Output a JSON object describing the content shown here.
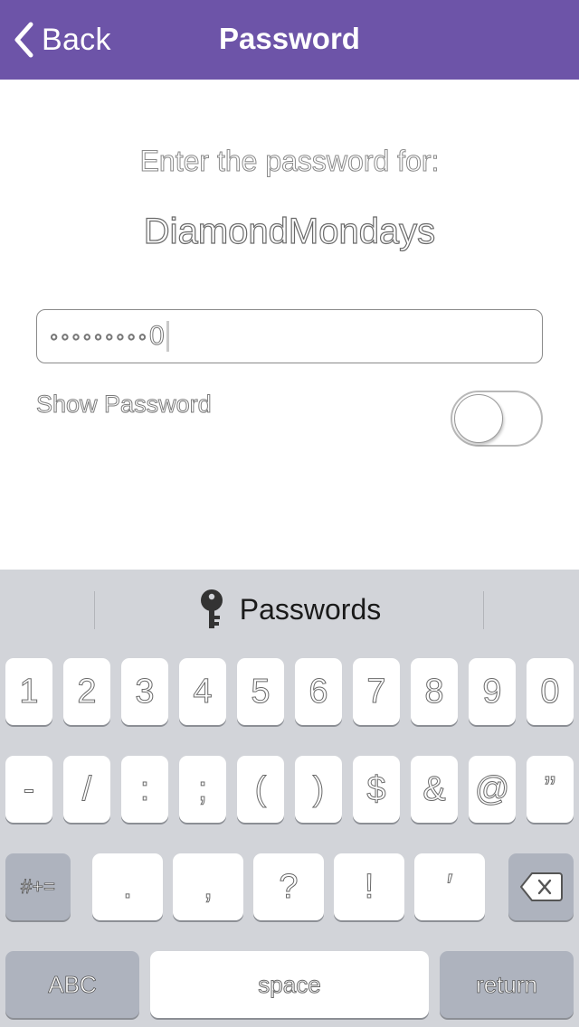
{
  "nav": {
    "back_label": "Back",
    "title": "Password",
    "bg_color": "#6d54a8"
  },
  "prompt": {
    "line1": "Enter the password for:",
    "network_name": "DiamondMondays"
  },
  "password_field": {
    "masked_value": "◦◦◦◦◦◦◦◦◦",
    "last_char": "0"
  },
  "show_password": {
    "label": "Show Password",
    "enabled": false
  },
  "keyboard": {
    "suggestion": {
      "icon": "key-icon",
      "label": "Passwords"
    },
    "row1": [
      "1",
      "2",
      "3",
      "4",
      "5",
      "6",
      "7",
      "8",
      "9",
      "0"
    ],
    "row2": [
      "-",
      "/",
      ":",
      ";",
      "(",
      ")",
      "$",
      "&",
      "@",
      "”"
    ],
    "row3": {
      "mode_label": "#+=",
      "keys": [
        ".",
        ",",
        "?",
        "!",
        "′"
      ],
      "delete_icon": "backspace-icon"
    },
    "row4": {
      "abc_label": "ABC",
      "space_label": "space",
      "return_label": "return"
    }
  }
}
